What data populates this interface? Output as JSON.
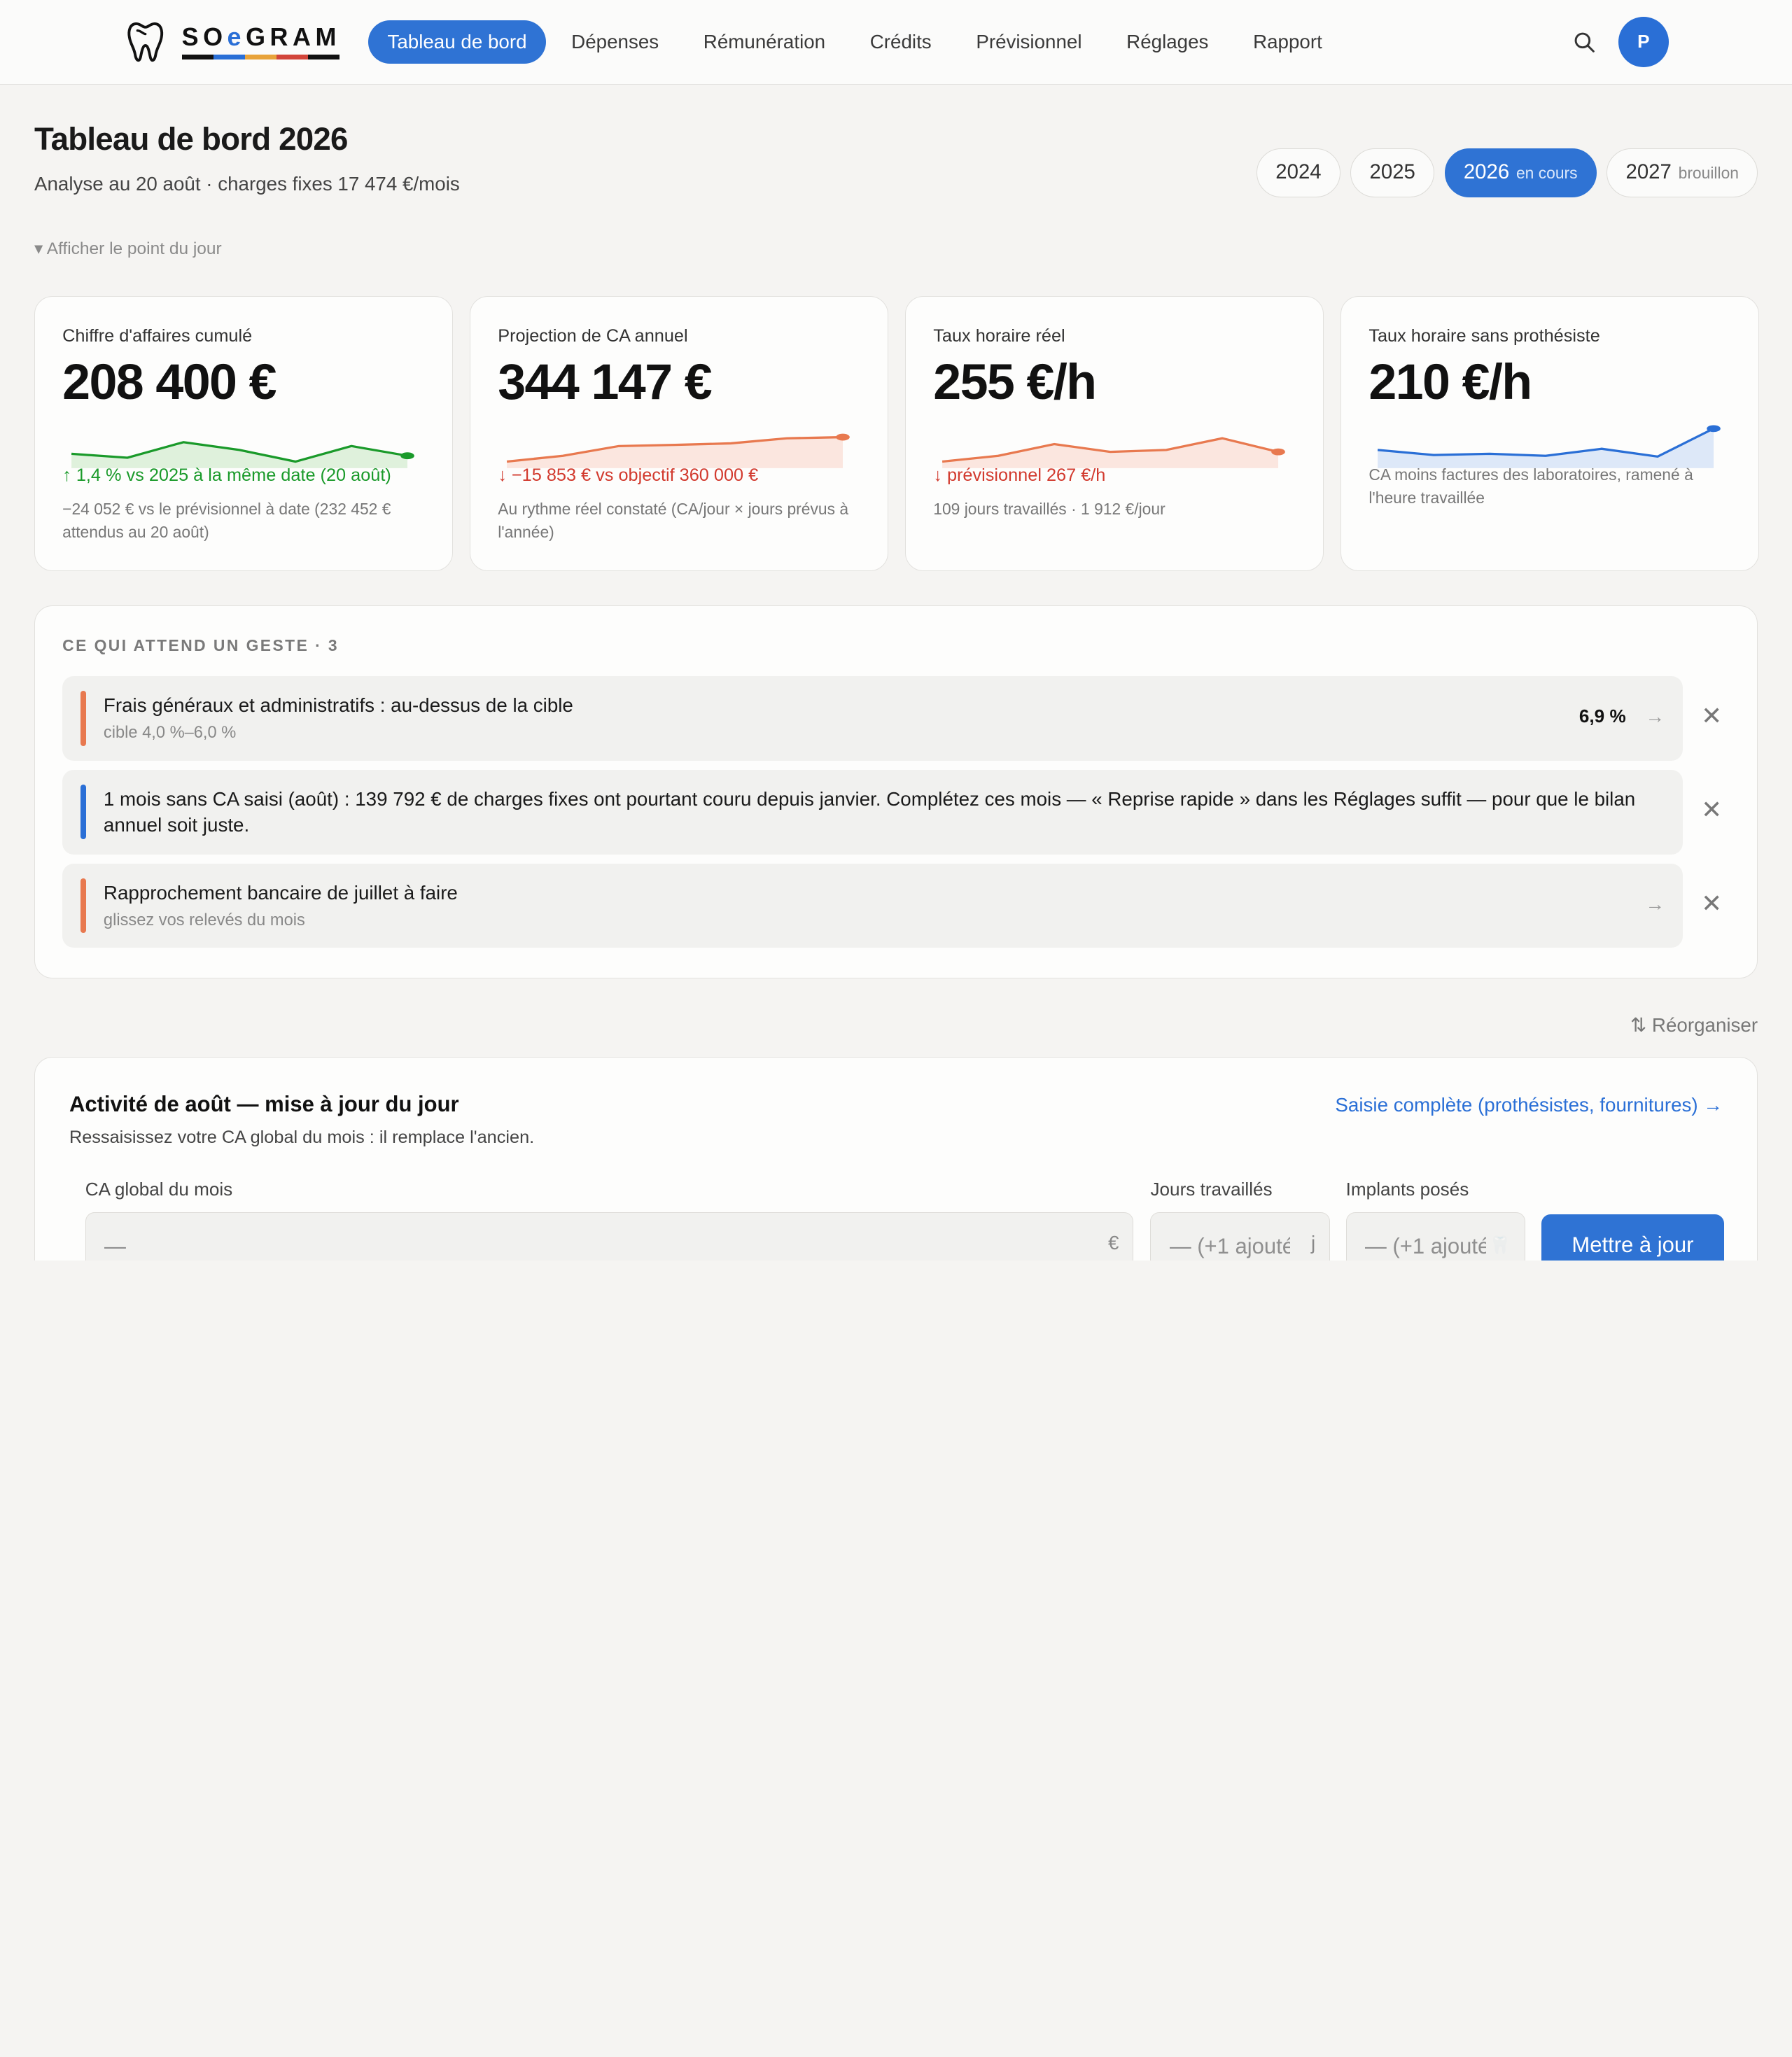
{
  "brand": {
    "name_pre": "SO",
    "name_e": "e",
    "name_post": "GRAM",
    "bar_colors": [
      "#111111",
      "#2a6fd6",
      "#e8a33a",
      "#d2453a",
      "#111111"
    ]
  },
  "nav": {
    "items": [
      {
        "label": "Tableau de bord",
        "active": true
      },
      {
        "label": "Dépenses"
      },
      {
        "label": "Rémunération"
      },
      {
        "label": "Crédits"
      },
      {
        "label": "Prévisionnel"
      },
      {
        "label": "Réglages"
      },
      {
        "label": "Rapport"
      }
    ],
    "search_icon": "search-icon",
    "avatar_initial": "P"
  },
  "header": {
    "title": "Tableau de bord 2026",
    "subtitle": "Analyse au 20 août · charges fixes 17 474 €/mois",
    "toggle_label": "▾ Afficher le point du jour",
    "years": [
      {
        "year": "2024",
        "tag": ""
      },
      {
        "year": "2025",
        "tag": ""
      },
      {
        "year": "2026",
        "tag": "en cours",
        "active": true
      },
      {
        "year": "2027",
        "tag": "brouillon"
      }
    ]
  },
  "kpis": [
    {
      "label": "Chiffre d'affaires cumulé",
      "value": "208 400 €",
      "delta": "↑ 1,4 % vs 2025 à la même date (20 août)",
      "delta_trend": "up",
      "note": "−24 052 € vs le prévisionnel à date (232 452 € attendus au 20 août)",
      "spark": [
        0.25,
        0.15,
        0.55,
        0.35,
        0.05,
        0.45,
        0.2
      ],
      "color": "#1a9a2a",
      "fill": "#dff1dc"
    },
    {
      "label": "Projection de CA annuel",
      "value": "344 147 €",
      "delta": "↓ −15 853 € vs objectif 360 000 €",
      "delta_trend": "down",
      "note": "Au rythme réel constaté (CA/jour × jours prévus à l'année)",
      "spark": [
        0.05,
        0.2,
        0.45,
        0.48,
        0.52,
        0.65,
        0.68
      ],
      "color": "#e8794f",
      "fill": "#fbe6df"
    },
    {
      "label": "Taux horaire réel",
      "value": "255 €/h",
      "delta": "↓ prévisionnel 267 €/h",
      "delta_trend": "down",
      "note": "109 jours travaillés · 1 912 €/jour",
      "spark": [
        0.05,
        0.2,
        0.5,
        0.3,
        0.35,
        0.65,
        0.3
      ],
      "color": "#e8794f",
      "fill": "#fbe6df"
    },
    {
      "label": "Taux horaire sans prothésiste",
      "value": "210 €/h",
      "delta": "",
      "delta_trend": "none",
      "note": "CA moins factures des laboratoires, ramené à l'heure travaillée",
      "spark": [
        0.35,
        0.22,
        0.25,
        0.2,
        0.38,
        0.18,
        0.9
      ],
      "color": "#2a6fd6",
      "fill": "#dde8f8"
    }
  ],
  "actions": {
    "heading": "CE QUI ATTEND UN GESTE · 3",
    "items": [
      {
        "title": "Frais généraux et administratifs : au-dessus de la cible",
        "subtitle": "cible 4,0 %–6,0 %",
        "metric": "6,9 %",
        "color": "#e8794f",
        "arrow": "→"
      },
      {
        "title": "1 mois sans CA saisi (août) : 139 792 € de charges fixes ont pourtant couru depuis janvier. Complétez ces mois — « Reprise rapide » dans les Réglages suffit — pour que le bilan annuel soit juste.",
        "subtitle": "",
        "metric": "",
        "color": "#2a6fd6",
        "arrow": ""
      },
      {
        "title": "Rapprochement bancaire de juillet à faire",
        "subtitle": "glissez vos relevés du mois",
        "metric": "",
        "color": "#e8794f",
        "arrow": "→"
      }
    ],
    "close_glyph": "✕"
  },
  "reorganise_label": "⇅ Réorganiser",
  "activity": {
    "title": "Activité de août — mise à jour du jour",
    "subtitle": "Ressaisissez votre CA global du mois : il remplace l'ancien.",
    "link": "Saisie complète (prothésistes, fournitures) →",
    "fields": {
      "ca": {
        "label": "CA global du mois",
        "placeholder": "—",
        "suffix": "€"
      },
      "days": {
        "label": "Jours travaillés",
        "placeholder": "— (+1 ajouté",
        "suffix": "j"
      },
      "implants": {
        "label": "Implants posés",
        "placeholder": "— (+1 ajouté",
        "suffix": "🦷"
      }
    },
    "submit_label": "Mettre à jour"
  }
}
